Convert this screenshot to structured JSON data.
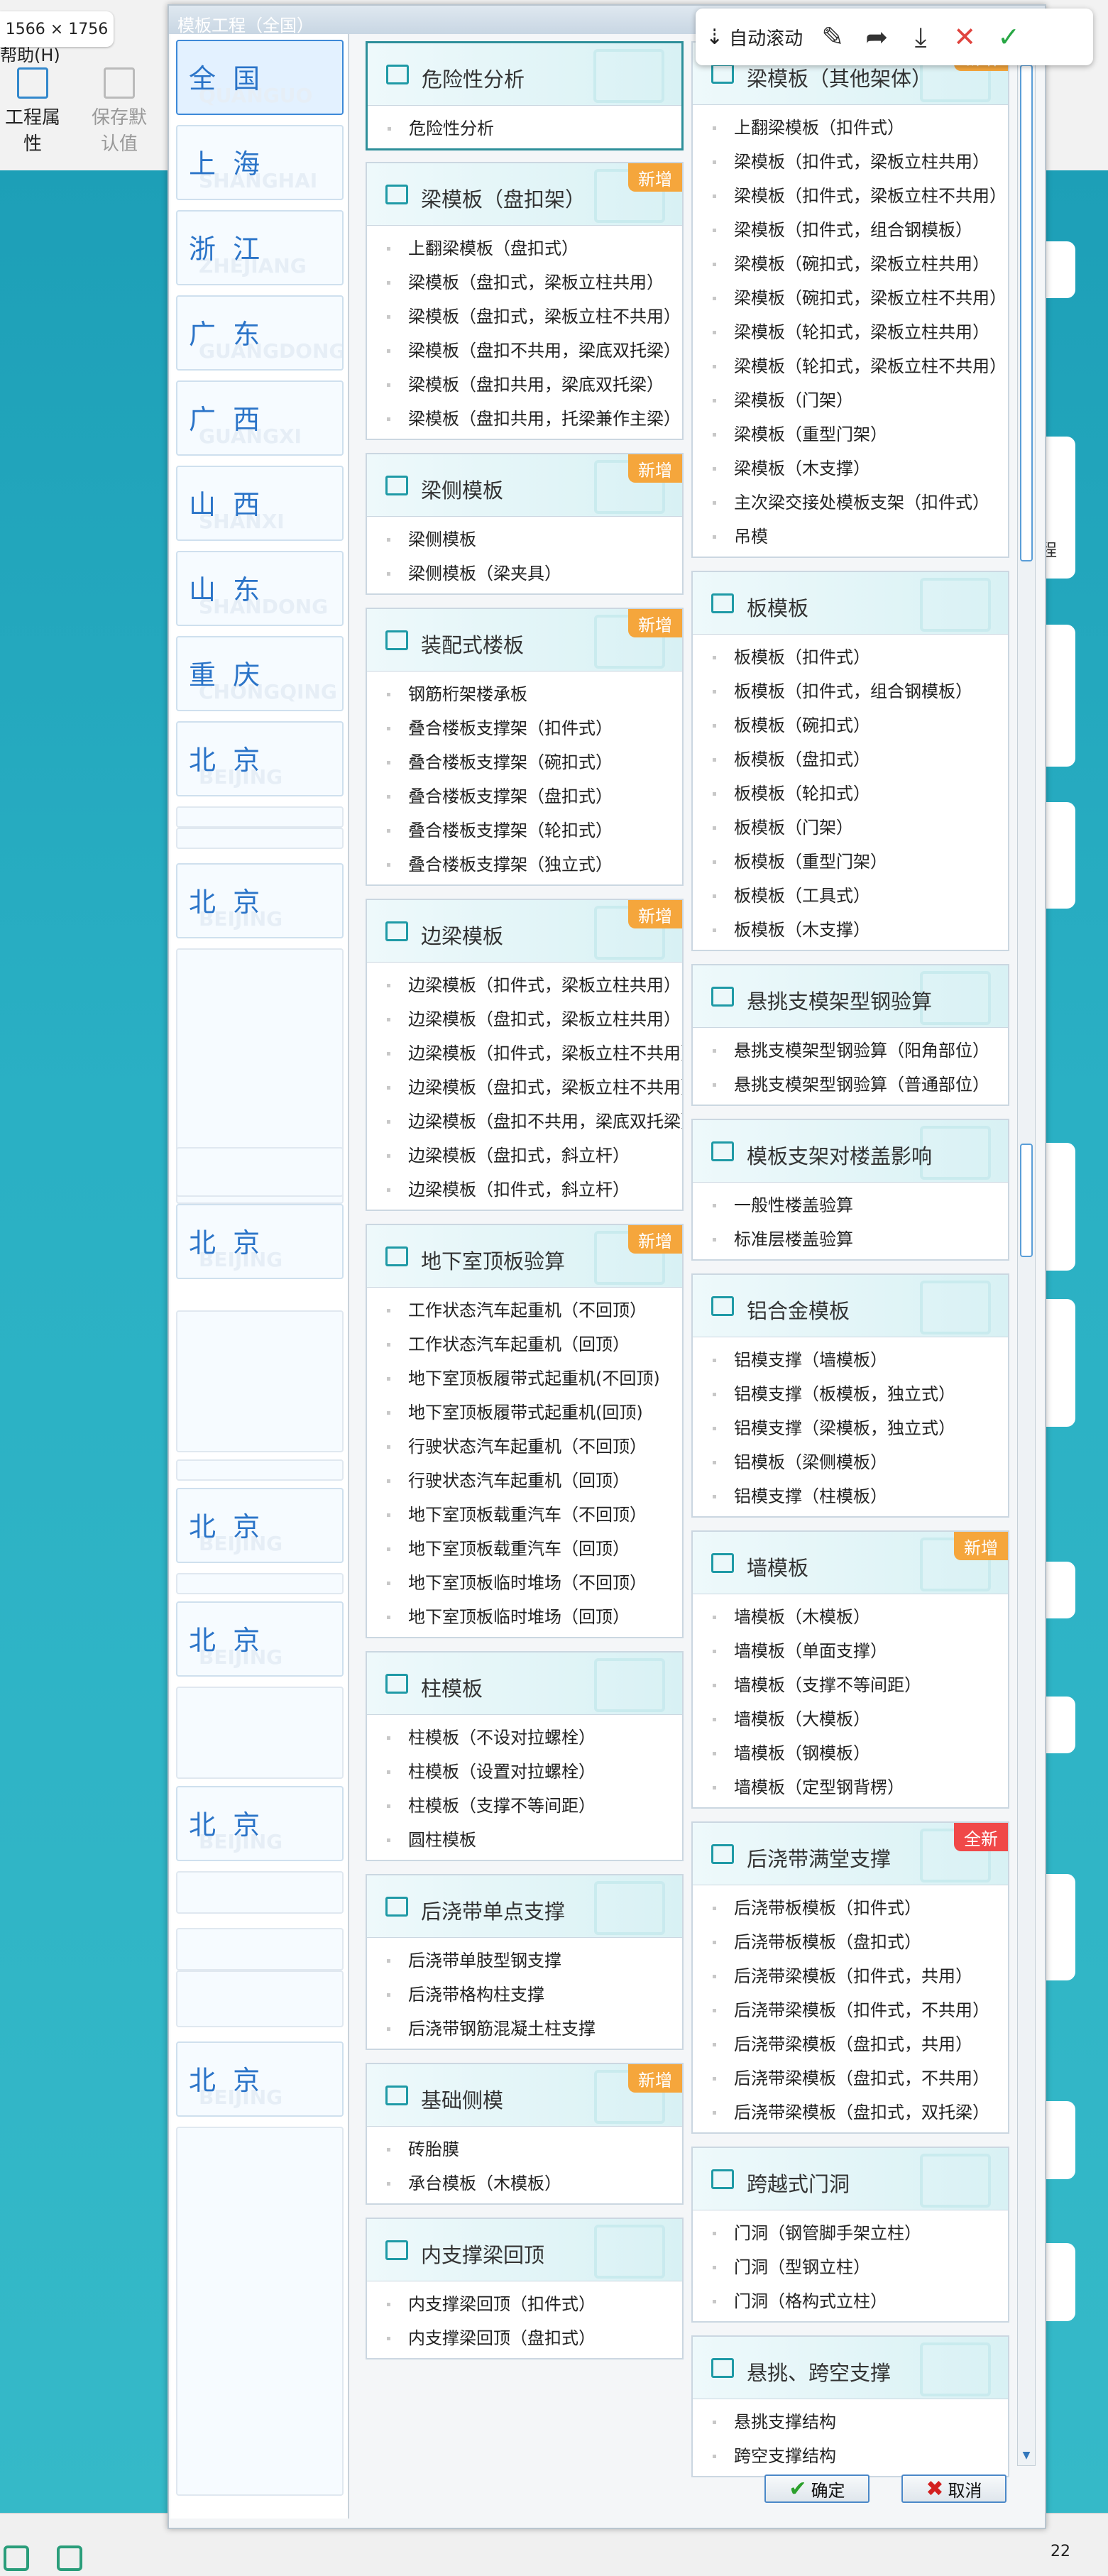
{
  "screen": {
    "dimension_badge": "1566 × 1756"
  },
  "app": {
    "menu_help": "帮助(H)",
    "ribbon": [
      {
        "label": "工程属性",
        "icon": "list-icon"
      },
      {
        "label": "保存默认值",
        "icon": "save-icon"
      }
    ],
    "right_card_text": "程"
  },
  "dialog": {
    "title": "模板工程（全国）",
    "toolbar": {
      "auto_scroll": "自动滚动",
      "icons": [
        "edit-icon",
        "share-icon",
        "download-icon",
        "close-icon",
        "check-icon"
      ]
    },
    "regions": [
      {
        "name": "全 国",
        "pinyin": "QUANGUO"
      },
      {
        "name": "上 海",
        "pinyin": "SHANGHAI"
      },
      {
        "name": "浙 江",
        "pinyin": "ZHEJIANG"
      },
      {
        "name": "广 东",
        "pinyin": "GUANGDONG"
      },
      {
        "name": "广 西",
        "pinyin": "GUANGXI"
      },
      {
        "name": "山 西",
        "pinyin": "SHANXI"
      },
      {
        "name": "山 东",
        "pinyin": "SHANDONG"
      },
      {
        "name": "重 庆",
        "pinyin": "CHONGQING"
      },
      {
        "name": "北 京",
        "pinyin": "BEIJING"
      },
      {
        "name": "北 京",
        "pinyin": "BEIJING"
      },
      {
        "name": "北 京",
        "pinyin": "BEIJING"
      },
      {
        "name": "北 京",
        "pinyin": "BEIJING"
      },
      {
        "name": "北 京",
        "pinyin": "BEIJING"
      },
      {
        "name": "北 京",
        "pinyin": "BEIJING"
      },
      {
        "name": "北 京",
        "pinyin": "BEIJING"
      }
    ],
    "modules_left": [
      {
        "title": "危险性分析",
        "badge": "",
        "items": [
          "危险性分析"
        ]
      },
      {
        "title": "梁模板（盘扣架）",
        "badge": "新增",
        "items": [
          "上翻梁模板（盘扣式）",
          "梁模板（盘扣式，梁板立柱共用）",
          "梁模板（盘扣式，梁板立柱不共用）",
          "梁模板（盘扣不共用，梁底双托梁）",
          "梁模板（盘扣共用，梁底双托梁）",
          "梁模板（盘扣共用，托梁兼作主梁）"
        ]
      },
      {
        "title": "梁侧模板",
        "badge": "新增",
        "items": [
          "梁侧模板",
          "梁侧模板（梁夹具）"
        ]
      },
      {
        "title": "装配式楼板",
        "badge": "新增",
        "items": [
          "钢筋桁架楼承板",
          "叠合楼板支撑架（扣件式）",
          "叠合楼板支撑架（碗扣式）",
          "叠合楼板支撑架（盘扣式）",
          "叠合楼板支撑架（轮扣式）",
          "叠合楼板支撑架（独立式）"
        ]
      },
      {
        "title": "边梁模板",
        "badge": "新增",
        "items": [
          "边梁模板（扣件式，梁板立柱共用）",
          "边梁模板（盘扣式，梁板立柱共用）",
          "边梁模板（扣件式，梁板立柱不共用）",
          "边梁模板（盘扣式，梁板立柱不共用）",
          "边梁模板（盘扣不共用，梁底双托梁）",
          "边梁模板（盘扣式，斜立杆）",
          "边梁模板（扣件式，斜立杆）"
        ]
      },
      {
        "title": "地下室顶板验算",
        "badge": "新增",
        "items": [
          "工作状态汽车起重机（不回顶）",
          "工作状态汽车起重机（回顶）",
          "地下室顶板履带式起重机(不回顶)",
          "地下室顶板履带式起重机(回顶)",
          "行驶状态汽车起重机（不回顶）",
          "行驶状态汽车起重机（回顶）",
          "地下室顶板载重汽车（不回顶）",
          "地下室顶板载重汽车（回顶）",
          "地下室顶板临时堆场（不回顶）",
          "地下室顶板临时堆场（回顶）"
        ]
      },
      {
        "title": "柱模板",
        "badge": "",
        "items": [
          "柱模板（不设对拉螺栓）",
          "柱模板（设置对拉螺栓）",
          "柱模板（支撑不等间距）",
          "圆柱模板"
        ]
      },
      {
        "title": "后浇带单点支撑",
        "badge": "",
        "items": [
          "后浇带单肢型钢支撑",
          "后浇带格构柱支撑",
          "后浇带钢筋混凝土柱支撑"
        ]
      },
      {
        "title": "基础侧模",
        "badge": "新增",
        "items": [
          "砖胎膜",
          "承台模板（木模板）"
        ]
      },
      {
        "title": "内支撑梁回顶",
        "badge": "",
        "items": [
          "内支撑梁回顶（扣件式）",
          "内支撑梁回顶（盘扣式）"
        ]
      }
    ],
    "modules_right": [
      {
        "title": "梁模板（其他架体）",
        "badge": "新增",
        "items": [
          "上翻梁模板（扣件式）",
          "梁模板（扣件式，梁板立柱共用）",
          "梁模板（扣件式，梁板立柱不共用）",
          "梁模板（扣件式，组合钢模板）",
          "梁模板（碗扣式，梁板立柱共用）",
          "梁模板（碗扣式，梁板立柱不共用）",
          "梁模板（轮扣式，梁板立柱共用）",
          "梁模板（轮扣式，梁板立柱不共用）",
          "梁模板（门架）",
          "梁模板（重型门架）",
          "梁模板（木支撑）",
          "主次梁交接处模板支架（扣件式）",
          "吊模"
        ]
      },
      {
        "title": "板模板",
        "badge": "",
        "items": [
          "板模板（扣件式）",
          "板模板（扣件式，组合钢模板）",
          "板模板（碗扣式）",
          "板模板（盘扣式）",
          "板模板（轮扣式）",
          "板模板（门架）",
          "板模板（重型门架）",
          "板模板（工具式）",
          "板模板（木支撑）"
        ]
      },
      {
        "title": "悬挑支模架型钢验算",
        "badge": "",
        "items": [
          "悬挑支模架型钢验算（阳角部位）",
          "悬挑支模架型钢验算（普通部位）"
        ]
      },
      {
        "title": "模板支架对楼盖影响",
        "badge": "",
        "items": [
          "一般性楼盖验算",
          "标准层楼盖验算"
        ]
      },
      {
        "title": "铝合金模板",
        "badge": "",
        "items": [
          "铝模支撑（墙模板）",
          "铝模支撑（板模板，独立式）",
          "铝模支撑（梁模板，独立式）",
          "铝模板（梁侧模板）",
          "铝模支撑（柱模板）"
        ]
      },
      {
        "title": "墙模板",
        "badge": "新增",
        "items": [
          "墙模板（木模板）",
          "墙模板（单面支撑）",
          "墙模板（支撑不等间距）",
          "墙模板（大模板）",
          "墙模板（钢模板）",
          "墙模板（定型钢背楞）"
        ]
      },
      {
        "title": "后浇带满堂支撑",
        "badge": "全新",
        "items": [
          "后浇带板模板（扣件式）",
          "后浇带板模板（盘扣式）",
          "后浇带梁模板（扣件式，共用）",
          "后浇带梁模板（扣件式，不共用）",
          "后浇带梁模板（盘扣式，共用）",
          "后浇带梁模板（盘扣式，不共用）",
          "后浇带梁模板（盘扣式，双托梁）"
        ]
      },
      {
        "title": "跨越式门洞",
        "badge": "",
        "items": [
          "门洞（钢管脚手架立柱）",
          "门洞（型钢立柱）",
          "门洞（格构式立柱）"
        ]
      },
      {
        "title": "悬挑、跨空支撑",
        "badge": "",
        "items": [
          "悬挑支撑结构",
          "跨空支撑结构"
        ]
      }
    ],
    "buttons": {
      "ok": "确定",
      "cancel": "取消"
    }
  },
  "taskbar": {
    "time": "22"
  }
}
